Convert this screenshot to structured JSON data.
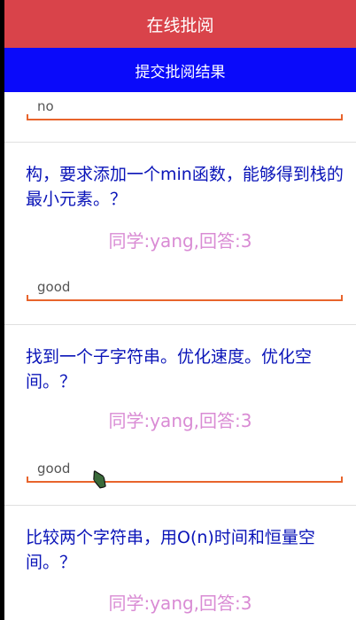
{
  "header": {
    "title": "在线批阅"
  },
  "toolbar": {
    "submit_label": "提交批阅结果"
  },
  "items": [
    {
      "question": "",
      "answer": "",
      "comment": "no"
    },
    {
      "question": "构，要求添加一个min函数，能够得到栈的最小元素。？",
      "answer": "同学:yang,回答:3",
      "comment": "good"
    },
    {
      "question": "找到一个子字符串。优化速度。优化空间。？",
      "answer": "同学:yang,回答:3",
      "comment": "good"
    },
    {
      "question": "比较两个字符串，用O(n)时间和恒量空间。？",
      "answer": "同学:yang,回答:3",
      "comment": ""
    }
  ],
  "colors": {
    "title_bar": "#d9434a",
    "submit_button": "#0a0afa",
    "question_text": "#0a14b8",
    "answer_text": "#d98bd4",
    "input_underline": "#e8642c"
  },
  "icons": {
    "pointer": "mouse-cursor-icon"
  }
}
